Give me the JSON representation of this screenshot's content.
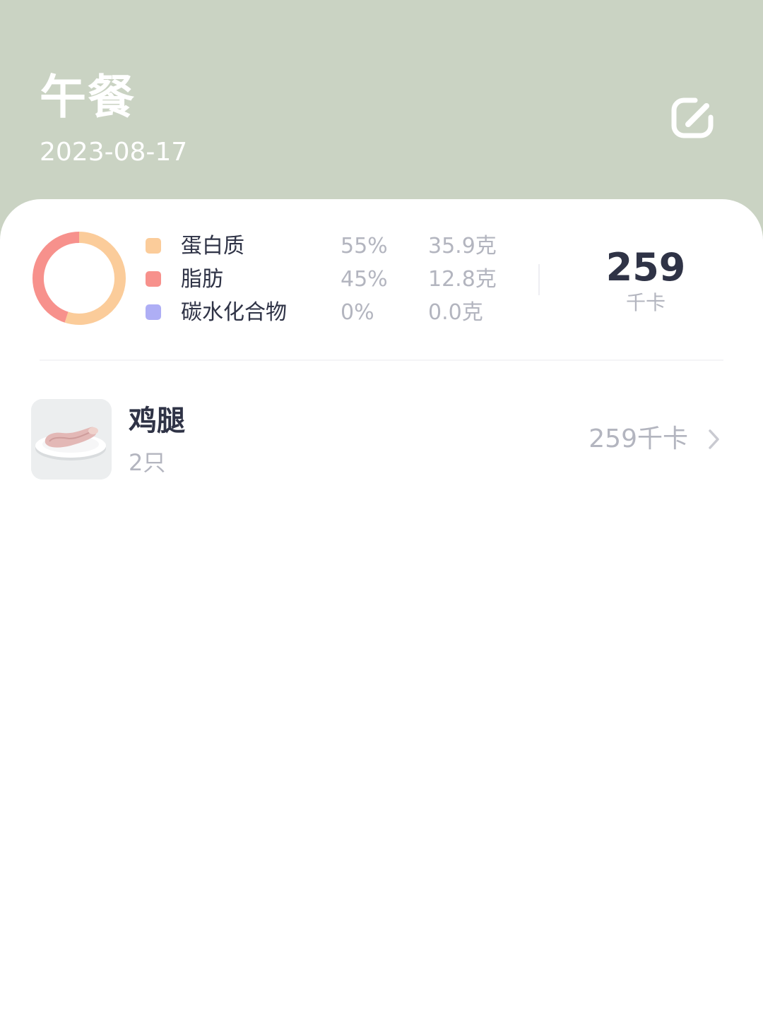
{
  "header": {
    "title": "午餐",
    "date": "2023-08-17",
    "edit_icon": "edit-icon"
  },
  "nutrition": {
    "items": [
      {
        "name": "蛋白质",
        "percent": "55%",
        "grams": "35.9克",
        "color": "#fbcc9a"
      },
      {
        "name": "脂肪",
        "percent": "45%",
        "grams": "12.8克",
        "color": "#f7918c"
      },
      {
        "name": "碳水化合物",
        "percent": "0%",
        "grams": "0.0克",
        "color": "#aeaef5"
      }
    ],
    "chart_data": {
      "type": "pie",
      "categories": [
        "蛋白质",
        "脂肪",
        "碳水化合物"
      ],
      "values": [
        55,
        45,
        0
      ]
    },
    "total_kcal": "259",
    "kcal_unit": "千卡"
  },
  "food_list": [
    {
      "name": "鸡腿",
      "quantity": "2只",
      "kcal": "259千卡",
      "thumb_icon": "chicken-leg-plate-image",
      "arrow_icon": "chevron-right-icon"
    }
  ]
}
